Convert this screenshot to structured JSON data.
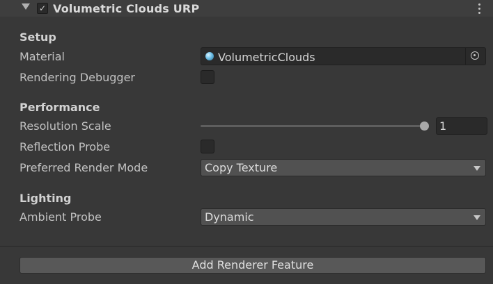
{
  "header": {
    "title": "Volumetric Clouds URP",
    "enabled": true,
    "check_glyph": "✓"
  },
  "sections": {
    "setup": "Setup",
    "performance": "Performance",
    "lighting": "Lighting"
  },
  "fields": {
    "material": {
      "label": "Material",
      "value": "VolumetricClouds",
      "icon": "material-sphere-icon"
    },
    "rendering_debugger": {
      "label": "Rendering Debugger",
      "checked": false
    },
    "resolution_scale": {
      "label": "Resolution Scale",
      "value": "1",
      "slider_fraction": 1.0
    },
    "reflection_probe": {
      "label": "Reflection Probe",
      "checked": false
    },
    "preferred_render_mode": {
      "label": "Preferred Render Mode",
      "value": "Copy Texture"
    },
    "ambient_probe": {
      "label": "Ambient Probe",
      "value": "Dynamic"
    }
  },
  "footer": {
    "add_button_label": "Add Renderer Feature"
  }
}
